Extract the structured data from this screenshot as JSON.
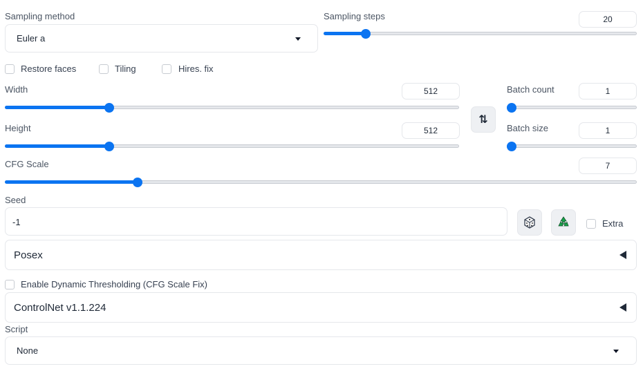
{
  "sampling": {
    "method_label": "Sampling method",
    "method_value": "Euler a",
    "steps_label": "Sampling steps",
    "steps_value": "20",
    "steps_fraction": 0.135
  },
  "checkboxes": {
    "restore_faces": "Restore faces",
    "tiling": "Tiling",
    "hires_fix": "Hires. fix"
  },
  "width": {
    "label": "Width",
    "value": "512",
    "fraction": 0.23
  },
  "height": {
    "label": "Height",
    "value": "512",
    "fraction": 0.23
  },
  "swap_icon": "⇅",
  "batch_count": {
    "label": "Batch count",
    "value": "1",
    "fraction": 0.0
  },
  "batch_size": {
    "label": "Batch size",
    "value": "1",
    "fraction": 0.0
  },
  "cfg": {
    "label": "CFG Scale",
    "value": "7",
    "fraction": 0.21
  },
  "seed": {
    "label": "Seed",
    "value": "-1",
    "extra_label": "Extra",
    "dice_icon": "dice-icon",
    "recycle_icon": "recycle-icon"
  },
  "posex": {
    "title": "Posex"
  },
  "dynamic_thresholding": {
    "label": "Enable Dynamic Thresholding (CFG Scale Fix)"
  },
  "controlnet": {
    "title": "ControlNet v1.1.224"
  },
  "script": {
    "label": "Script",
    "value": "None"
  },
  "colors": {
    "accent": "#0b74f1",
    "recycle": "#16a34a"
  }
}
